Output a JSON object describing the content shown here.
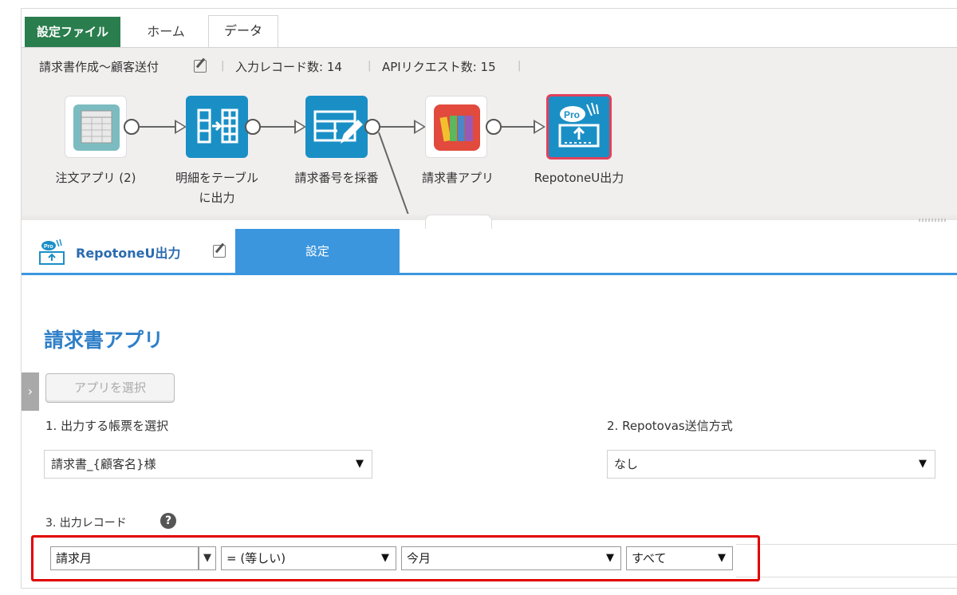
{
  "tabs": {
    "settings": "設定ファイル",
    "home": "ホーム",
    "data": "データ"
  },
  "info": {
    "flow_name": "請求書作成〜顧客送付",
    "input_records": "入力レコード数: 14",
    "api_requests": "APIリクエスト数: 15"
  },
  "flow_nodes": [
    {
      "label": "注文アプリ (2)",
      "icon": "spreadsheet-icon",
      "color": "#7cbcc0"
    },
    {
      "label_line1": "明細をテーブル",
      "label_line2": "に出力",
      "icon": "table-output-icon",
      "color": "#1a8fc6"
    },
    {
      "label": "請求番号を採番",
      "icon": "edit-table-icon",
      "color": "#1a8fc6"
    },
    {
      "label": "請求書アプリ",
      "icon": "binders-icon",
      "color": "#e14a3c"
    },
    {
      "label": "RepotoneU出力",
      "icon": "repotone-pro-icon",
      "color": "#1a8fc6",
      "accent": "#e0405a"
    }
  ],
  "panel": {
    "title": "RepotoneU出力",
    "tab": "設定"
  },
  "app_section": {
    "title": "請求書アプリ",
    "select_button": "アプリを選択",
    "toggle": "›"
  },
  "fields": {
    "report_label": "1. 出力する帳票を選択",
    "report_value": "請求書_{顧客名}様",
    "send_label": "2. Repotovas送信方式",
    "send_value": "なし",
    "records_label": "3. 出力レコード",
    "help": "?"
  },
  "condition": {
    "field": "請求月",
    "operator": "= (等しい)",
    "value": "今月",
    "scope": "すべて"
  },
  "caret": "▼",
  "colors": {
    "green": "#2a7d4d",
    "blue": "#3b96de",
    "red": "#e10000"
  }
}
